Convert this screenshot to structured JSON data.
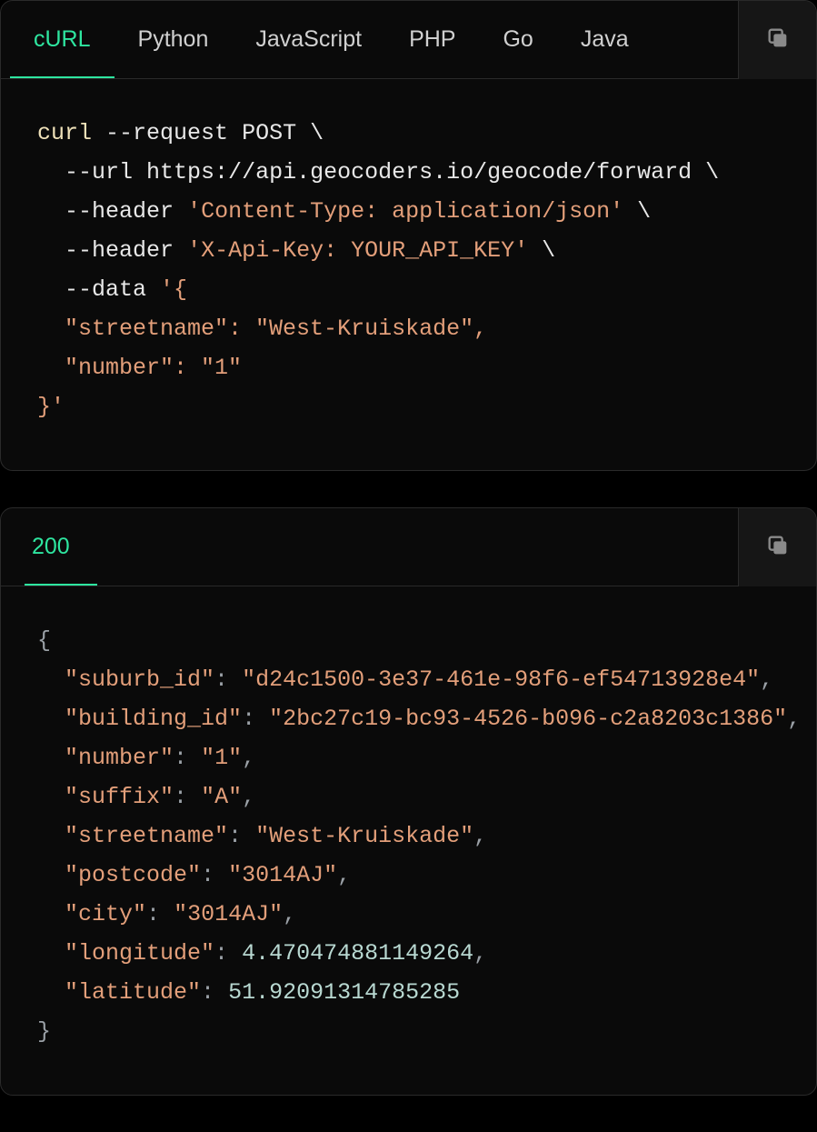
{
  "request": {
    "tabs": [
      "cURL",
      "Python",
      "JavaScript",
      "PHP",
      "Go",
      "Java"
    ],
    "active_tab": "cURL",
    "code": {
      "cmd": "curl",
      "method": "POST",
      "url": "https://api.geocoders.io/geocode/forward",
      "headers": [
        "'Content-Type: application/json'",
        "'X-Api-Key: YOUR_API_KEY'"
      ],
      "body_lines": [
        "\"streetname\": \"West-Kruiskade\",",
        "\"number\": \"1\""
      ]
    }
  },
  "response": {
    "status": "200",
    "body": [
      {
        "key": "\"suburb_id\"",
        "value": "\"d24c1500-3e37-461e-98f6-ef54713928e4\"",
        "type": "str",
        "comma": true
      },
      {
        "key": "\"building_id\"",
        "value": "\"2bc27c19-bc93-4526-b096-c2a8203c1386\"",
        "type": "str",
        "comma": true
      },
      {
        "key": "\"number\"",
        "value": "\"1\"",
        "type": "str",
        "comma": true
      },
      {
        "key": "\"suffix\"",
        "value": "\"A\"",
        "type": "str",
        "comma": true
      },
      {
        "key": "\"streetname\"",
        "value": "\"West-Kruiskade\"",
        "type": "str",
        "comma": true
      },
      {
        "key": "\"postcode\"",
        "value": "\"3014AJ\"",
        "type": "str",
        "comma": true
      },
      {
        "key": "\"city\"",
        "value": "\"3014AJ\"",
        "type": "str",
        "comma": true
      },
      {
        "key": "\"longitude\"",
        "value": "4.470474881149264",
        "type": "num",
        "comma": true
      },
      {
        "key": "\"latitude\"",
        "value": "51.92091314785285",
        "type": "num",
        "comma": false
      }
    ]
  }
}
